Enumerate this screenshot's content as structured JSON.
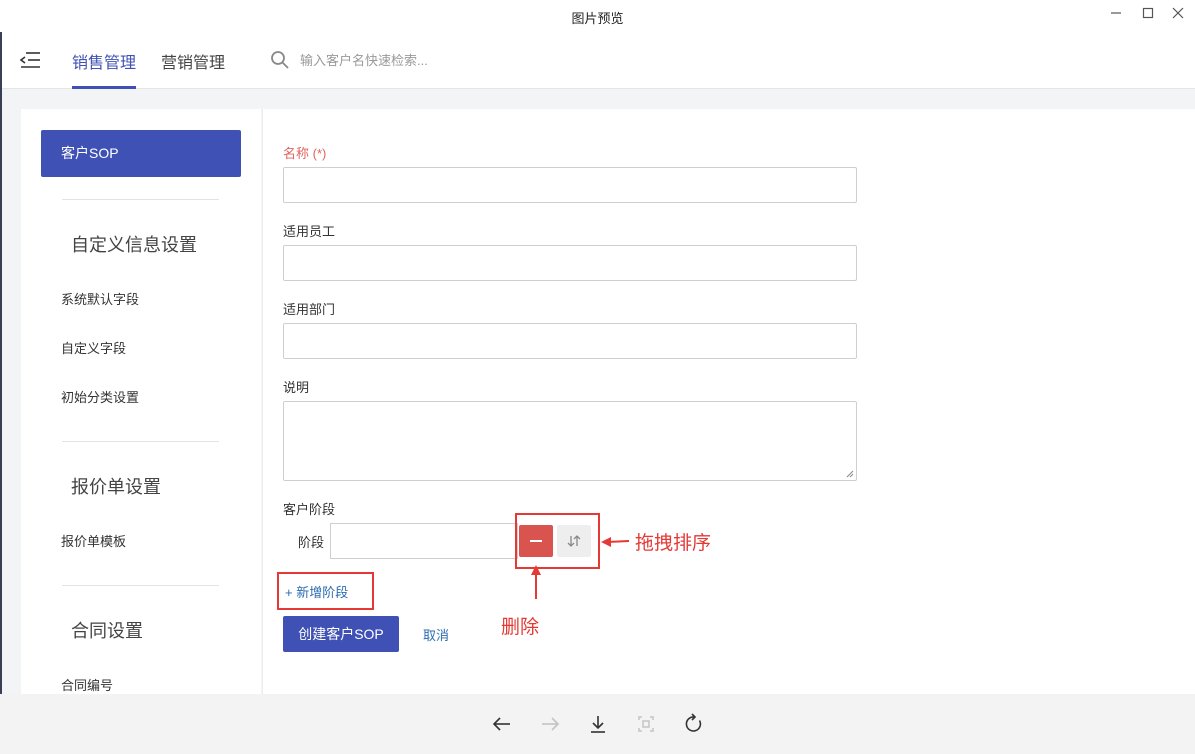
{
  "window": {
    "title": "图片预览"
  },
  "topnav": {
    "tabs": [
      {
        "label": "销售管理",
        "active": true
      },
      {
        "label": "营销管理",
        "active": false
      }
    ],
    "search_placeholder": "输入客户名快速检索..."
  },
  "sidebar": {
    "active_item": "客户SOP",
    "sections": [
      {
        "title": "自定义信息设置",
        "items": [
          "系统默认字段",
          "自定义字段",
          "初始分类设置"
        ]
      },
      {
        "title": "报价单设置",
        "items": [
          "报价单模板"
        ]
      },
      {
        "title": "合同设置",
        "items": [
          "合同编号"
        ]
      }
    ]
  },
  "form": {
    "name_label": "名称 (*)",
    "staff_label": "适用员工",
    "dept_label": "适用部门",
    "desc_label": "说明",
    "stages_label": "客户阶段",
    "stage_item_label": "阶段",
    "add_stage": "+ 新增阶段",
    "create_button": "创建客户SOP",
    "cancel_button": "取消"
  },
  "annotations": {
    "drag_sort": "拖拽排序",
    "delete": "删除"
  },
  "colors": {
    "accent": "#3f51b5",
    "danger": "#d9534f",
    "annotation": "#e53935",
    "link": "#2b6cb0"
  }
}
